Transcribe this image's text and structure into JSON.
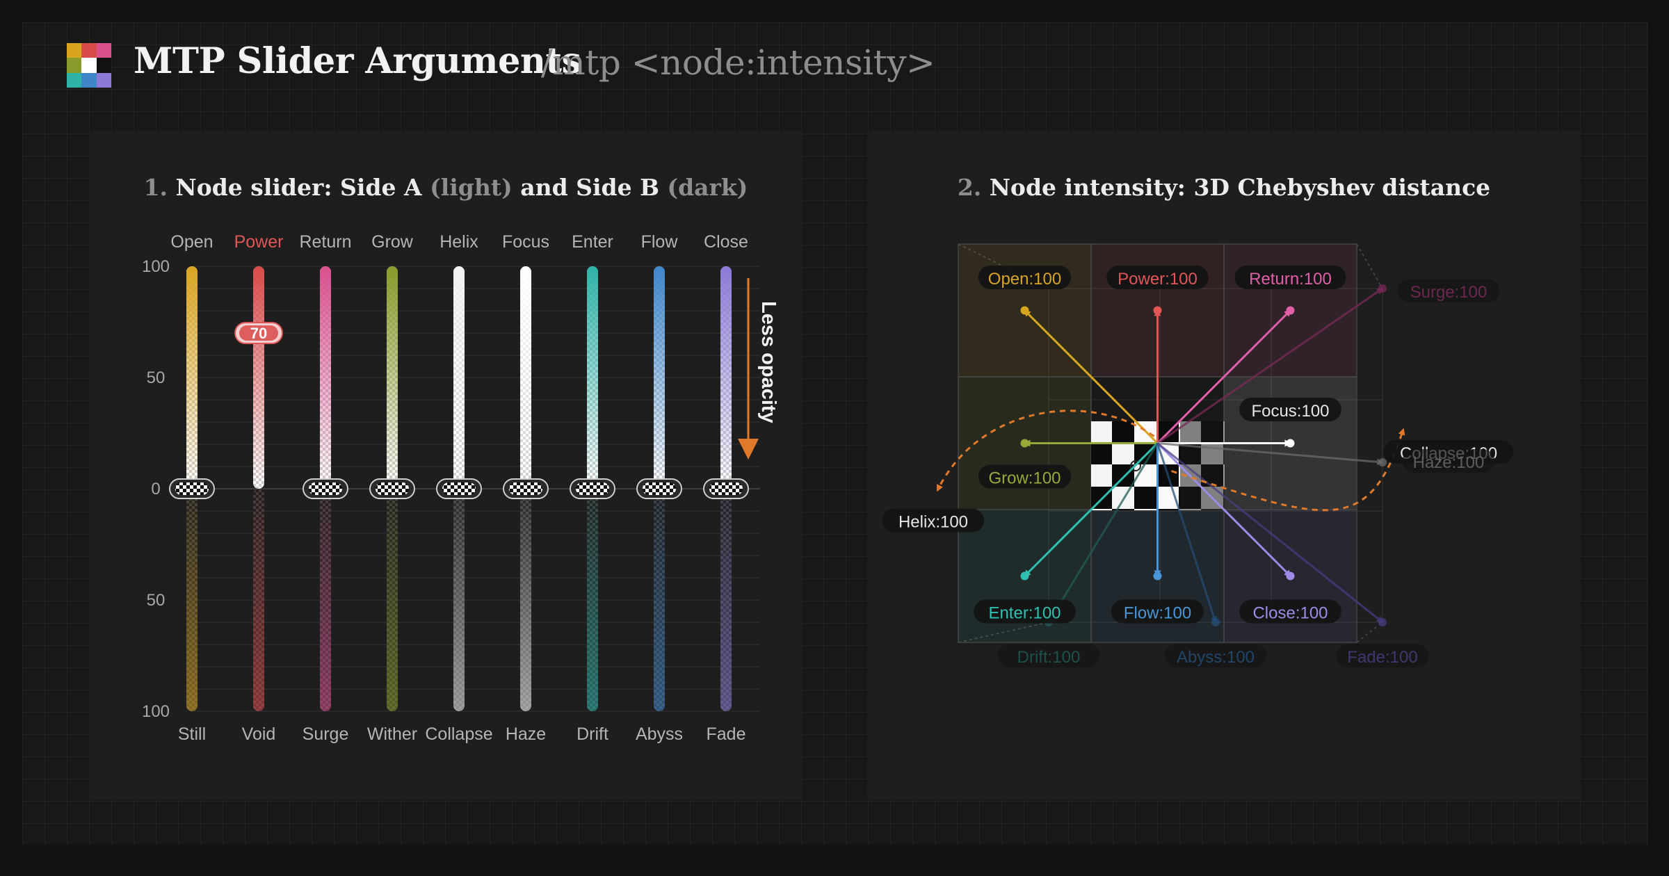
{
  "header": {
    "title": "MTP Slider Arguments",
    "subtitle": "/mtp <node:intensity>",
    "logo_colors": [
      "#d9a521",
      "#d94a4a",
      "#d9508f",
      "#8a9a2b",
      "#ffffff",
      "#111111",
      "#2fb3a8",
      "#3f86c9",
      "#8d7ad6"
    ]
  },
  "panel1": {
    "title_number": "1.",
    "title_part1": "Node slider: Side A",
    "title_light": "(light)",
    "title_part2": "and Side B",
    "title_dark": "(dark)",
    "y_ticks_top": [
      "100",
      "50",
      "0"
    ],
    "y_ticks_bottom": [
      "50",
      "100"
    ],
    "annotation": "Less opacity",
    "selected_value": "70",
    "sliders": [
      {
        "top": "Open",
        "bottom": "Still",
        "color": "#d9a521",
        "value_a": 0
      },
      {
        "top": "Power",
        "bottom": "Void",
        "color": "#d94a4a",
        "value_a": 70,
        "active": true
      },
      {
        "top": "Return",
        "bottom": "Surge",
        "color": "#d9508f",
        "value_a": 0
      },
      {
        "top": "Grow",
        "bottom": "Wither",
        "color": "#8a9a2b",
        "value_a": 0
      },
      {
        "top": "Helix",
        "bottom": "Collapse",
        "color": "#f2f2f2",
        "value_a": 0
      },
      {
        "top": "Focus",
        "bottom": "Haze",
        "color": "#ffffff",
        "value_a": 0
      },
      {
        "top": "Enter",
        "bottom": "Drift",
        "color": "#2fb3a8",
        "value_a": 0
      },
      {
        "top": "Flow",
        "bottom": "Abyss",
        "color": "#3f86c9",
        "value_a": 0
      },
      {
        "top": "Close",
        "bottom": "Fade",
        "color": "#8d7ad6",
        "value_a": 0
      }
    ]
  },
  "panel2": {
    "title_number": "2.",
    "title_text": "Node intensity: 3D Chebyshev distance",
    "nodes": [
      {
        "label": "Open:100",
        "color": "#d9a521"
      },
      {
        "label": "Power:100",
        "color": "#e05555"
      },
      {
        "label": "Return:100",
        "color": "#e060a8"
      },
      {
        "label": "Surge:100",
        "color": "#7a2a5a"
      },
      {
        "label": "Focus:100",
        "color": "#ffffff"
      },
      {
        "label": "Collapse:100",
        "color": "#bdbdbd"
      },
      {
        "label": "Grow:100",
        "color": "#9aa83a"
      },
      {
        "label": "Helix:100",
        "color": "#dddddd"
      },
      {
        "label": "Haze:100",
        "color": "#6a6a6a"
      },
      {
        "label": "Enter:100",
        "color": "#2fc0b2"
      },
      {
        "label": "Flow:100",
        "color": "#4a95d8"
      },
      {
        "label": "Close:100",
        "color": "#a08ae8"
      },
      {
        "label": "Drift:100",
        "color": "#1f5c57"
      },
      {
        "label": "Abyss:100",
        "color": "#244d78"
      },
      {
        "label": "Fade:100",
        "color": "#4a3c80"
      }
    ],
    "helix_arc_color": "#e07a2a"
  }
}
